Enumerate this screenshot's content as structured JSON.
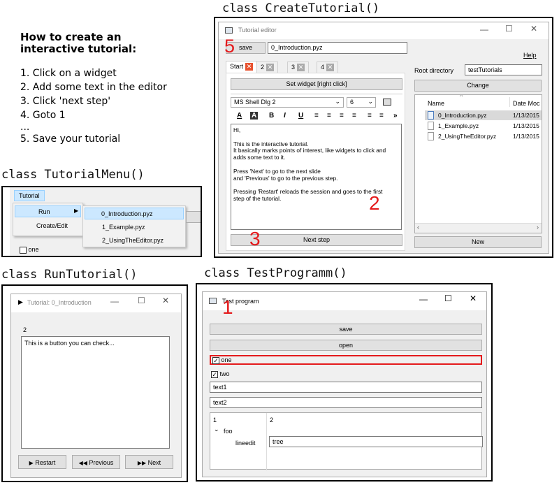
{
  "instructions": {
    "title": "How to create an\ninteractive tutorial:",
    "steps": [
      "1. Click on a widget",
      "2. Add some text in the editor",
      "3. Click 'next step'",
      "4. Goto 1",
      "...",
      "5. Save your tutorial"
    ]
  },
  "labels": {
    "create": "class CreateTutorial()",
    "menu": "class TutorialMenu()",
    "run": "class RunTutorial()",
    "test": "class TestProgramm()"
  },
  "editor": {
    "title": "Tutorial editor",
    "save": "save",
    "filename": "0_Introduction.pyz",
    "help": "Help",
    "tabs": [
      {
        "label": "Start"
      },
      {
        "label": "2"
      },
      {
        "label": "3"
      },
      {
        "label": "4"
      }
    ],
    "set_widget": "Set widget [right click]",
    "font": "MS Shell Dlg 2",
    "size": "6",
    "format": {
      "a": "A",
      "ahl": "A",
      "b": "B",
      "i": "I",
      "u": "U",
      "more": "»"
    },
    "text": [
      "Hi,",
      "",
      "This is the interactive tutorial.",
      "It basically marks points of interest, like widgets to click and",
      "adds some text to it.",
      "",
      "Press 'Next' to go to the next slide",
      "and 'Previous' to go to the previous step.",
      "",
      "Pressing 'Restart' reloads the session and goes to the first",
      "step of the tutorial."
    ],
    "next_step": "Next step",
    "root_label": "Root directory",
    "root_value": "testTutorials",
    "change": "Change",
    "col_name": "Name",
    "col_date": "Date Moc",
    "files": [
      {
        "name": "0_Introduction.pyz",
        "date": "1/13/2015"
      },
      {
        "name": "1_Example.pyz",
        "date": "1/13/2015"
      },
      {
        "name": "2_UsingTheEditor.pyz",
        "date": "1/13/2015"
      }
    ],
    "new": "New",
    "marker5": "5",
    "marker2": "2",
    "marker3": "3"
  },
  "menu": {
    "menubar": "Tutorial",
    "items": [
      "Run",
      "Create/Edit"
    ],
    "submenu": [
      "0_Introduction.pyz",
      "1_Example.pyz",
      "2_UsingTheEditor.pyz"
    ],
    "checkbox": "one"
  },
  "run": {
    "title": "Tutorial: 0_Introduction",
    "step": "2",
    "text": "This is a button you can check...",
    "restart": "Restart",
    "previous": "Previous",
    "next": "Next"
  },
  "test": {
    "title": "Test program",
    "save": "save",
    "open": "open",
    "one": "one",
    "two": "two",
    "text1": "text1",
    "text2": "text2",
    "tree_col1": "1",
    "tree_col2": "2",
    "foo": "foo",
    "lineedit": "lineedit",
    "tree_value": "tree",
    "marker1": "1"
  },
  "colors": {
    "accent_red": "#e41a1c",
    "selection": "#cce8ff"
  }
}
